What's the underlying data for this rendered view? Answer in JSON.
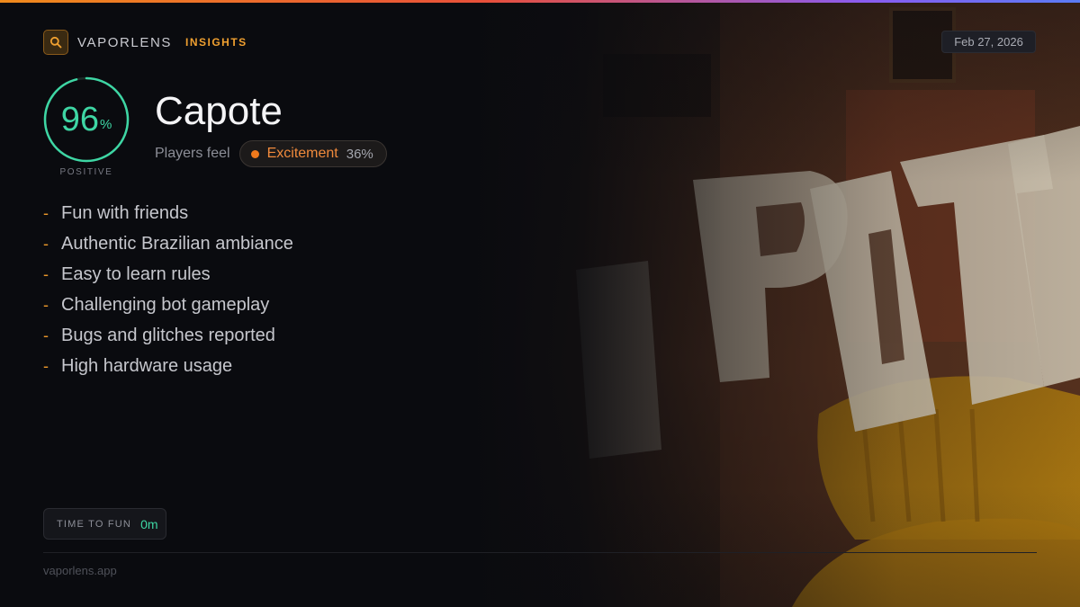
{
  "brand": {
    "name": "VAPORLENS",
    "section": "INSIGHTS"
  },
  "date": "Feb 27, 2026",
  "score": {
    "value": "96",
    "unit": "%",
    "label": "POSITIVE",
    "fraction": 0.96
  },
  "game": {
    "title": "Capote"
  },
  "feel": {
    "label": "Players feel",
    "emotion": "Excitement",
    "percent": "36%"
  },
  "bullets": [
    "Fun with friends",
    "Authentic Brazilian ambiance",
    "Easy to learn rules",
    "Challenging bot gameplay",
    "Bugs and glitches reported",
    "High hardware usage"
  ],
  "time_to_fun": {
    "label": "TIME TO FUN",
    "value": "0m"
  },
  "footer": {
    "url": "vaporlens.app"
  },
  "colors": {
    "accent": "#3ed6a4",
    "brand": "#f0a030",
    "emotion": "#f07a1c"
  },
  "icons": {
    "brand": "search-icon"
  }
}
